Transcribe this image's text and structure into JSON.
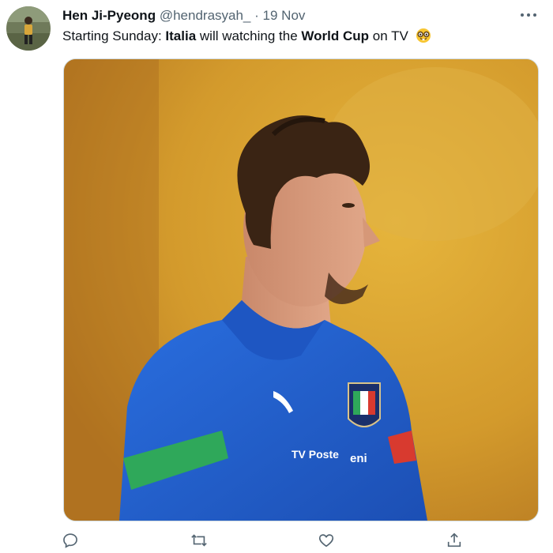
{
  "author": {
    "name": "Hen Ji-Pyeong",
    "handle": "@hendrasyah_",
    "separator": "·",
    "date": "19 Nov"
  },
  "tweet": {
    "text_parts": [
      "Starting Sunday: ",
      "Italia",
      " will watching the ",
      "World Cup",
      " on TV"
    ],
    "emoji": "nerd-face-emoji"
  },
  "photo": {
    "jersey_text": "TV Poste",
    "sponsor_text": "eni",
    "description_icon": "soccer-player-photo"
  },
  "actions": [
    "reply-icon",
    "retweet-icon",
    "like-icon",
    "share-icon"
  ],
  "colors": {
    "text": "#0f1419",
    "secondary": "#536471",
    "border": "#cfd9de",
    "jersey_blue": "#1e5fc9",
    "jersey_green": "#2fa85a"
  }
}
